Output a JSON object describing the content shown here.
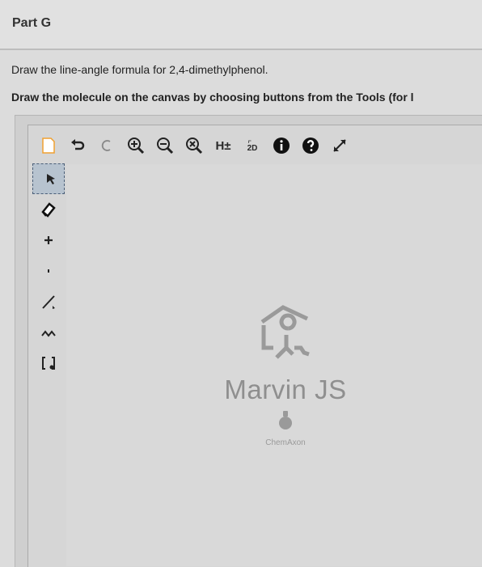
{
  "part": {
    "title": "Part G"
  },
  "question": {
    "text": "Draw the line-angle formula for 2,4-dimethylphenol."
  },
  "instruction": {
    "text": "Draw the molecule on the canvas by choosing buttons from the Tools (for l"
  },
  "toolbar": {
    "hydrogens_label": "H±",
    "twod_label": "2D"
  },
  "logo": {
    "name": "Marvin JS",
    "company": "ChemAxon"
  },
  "colors": {
    "background": "#dcdcdc",
    "toolbar_icon": "#2a2a2a",
    "selected_tool": "#b7c3cf",
    "logo_gray": "#8f8f8f"
  }
}
